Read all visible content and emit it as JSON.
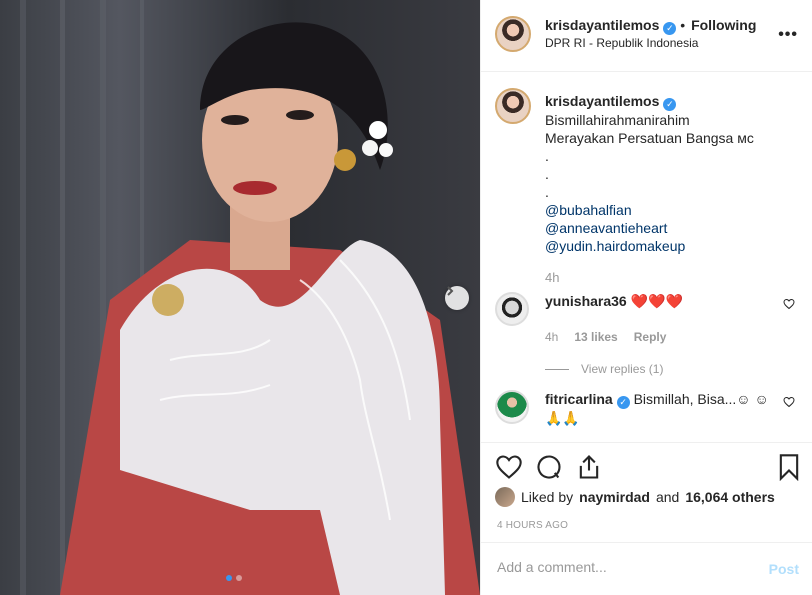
{
  "post": {
    "username": "krisdayantilemos",
    "following_label": "Following",
    "separator": "•",
    "location": "DPR RI - Republik Indonesia",
    "more_icon": "more-icon"
  },
  "caption": {
    "username": "krisdayantilemos",
    "lines": [
      "Bismillahirahmanirahim",
      "Merayakan Persatuan Bangsa ᴍᴄ",
      ".",
      ".",
      "."
    ],
    "mentions": [
      "@bubahalfian",
      "@anneavantieheart",
      "@yudin.hairdomakeup"
    ],
    "time": "4h"
  },
  "comments": [
    {
      "username": "yunishara36",
      "text": "❤️❤️❤️",
      "time": "4h",
      "likes": "13 likes",
      "reply_label": "Reply",
      "view_replies": "View replies (1)"
    },
    {
      "username": "fitricarlina",
      "text": "Bismillah, Bisa...☺ ☺ 🙏🙏"
    }
  ],
  "liked_by": {
    "prefix": "Liked by",
    "user": "naymirdad",
    "connector": "and",
    "others": "16,064 others"
  },
  "post_time": "4 HOURS AGO",
  "add_comment": {
    "placeholder": "Add a comment...",
    "post_label": "Post"
  },
  "colors": {
    "accent": "#3897f0",
    "heart": "#ed4956",
    "muted": "#999999",
    "post_disabled": "#b2dffc"
  }
}
